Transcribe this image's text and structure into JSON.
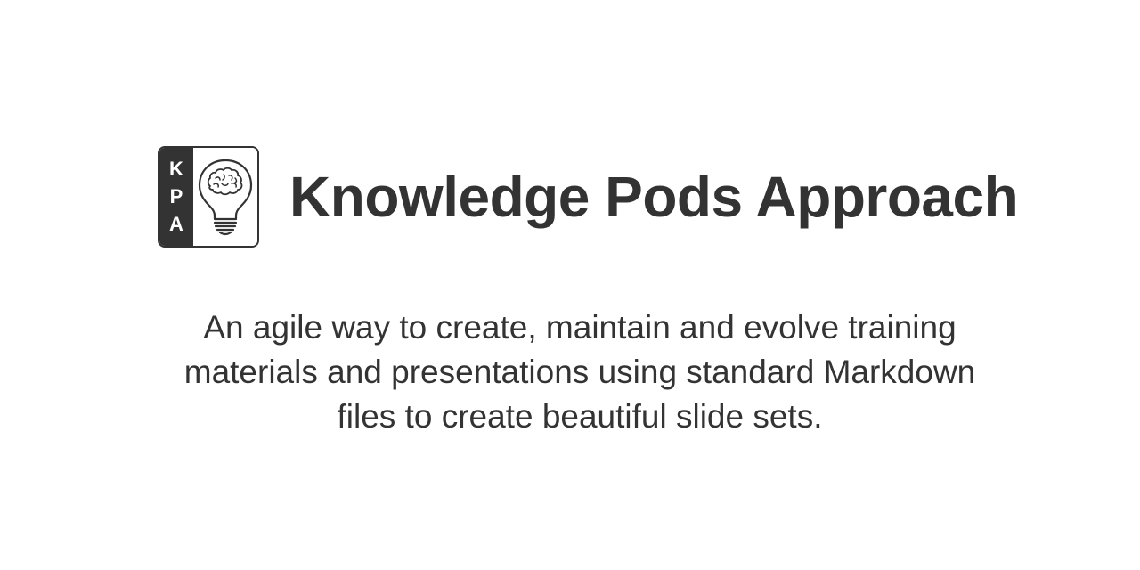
{
  "logo": {
    "letters": [
      "K",
      "P",
      "A"
    ],
    "icon": "lightbulb-brain-icon"
  },
  "title": {
    "part1": "Knowledge ",
    "part2": "Pods",
    "part3": " Approach"
  },
  "tagline": {
    "line1": "An agile way to create, maintain and evolve training",
    "line2": "materials and presentations using standard Markdown",
    "line3": "files to create beautiful slide sets."
  },
  "colors": {
    "text": "#333333",
    "background": "#ffffff"
  }
}
